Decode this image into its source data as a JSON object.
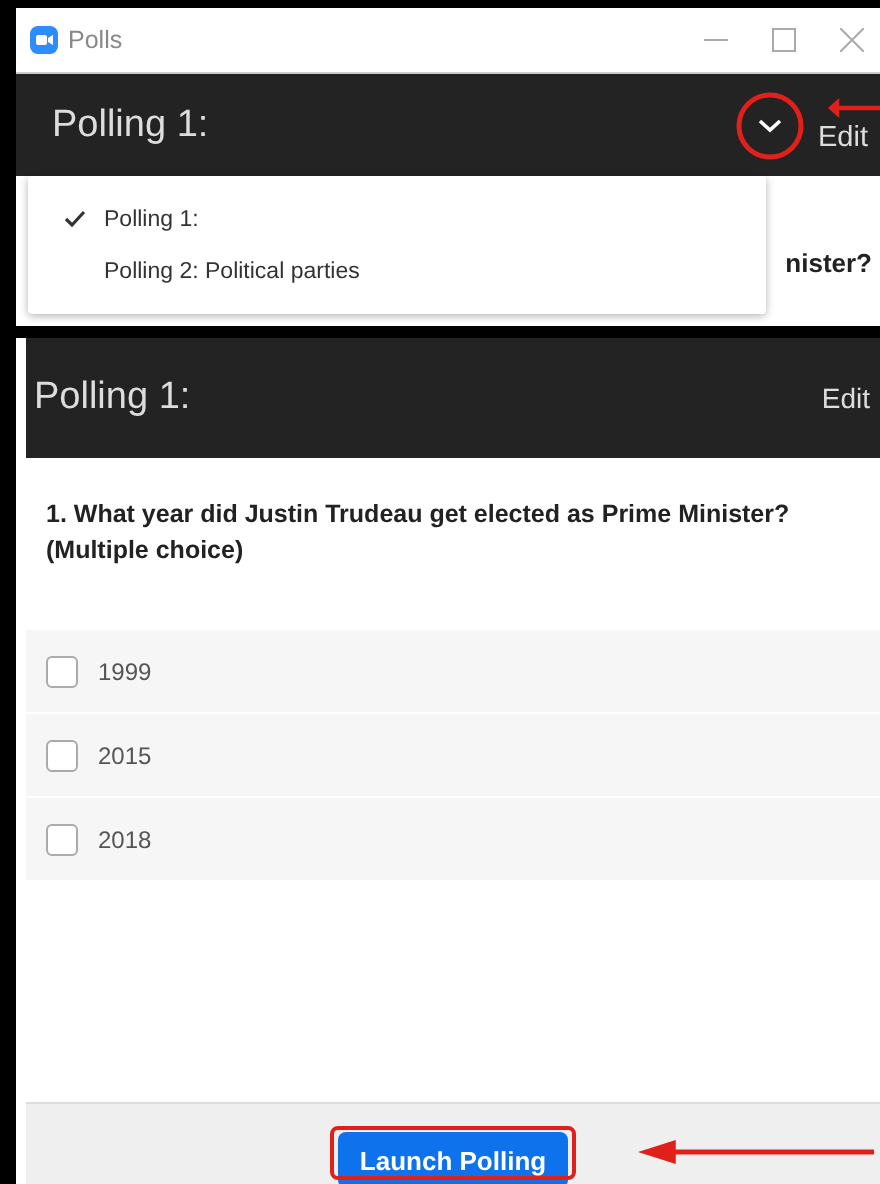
{
  "window": {
    "title": "Polls"
  },
  "header": {
    "title": "Polling 1:",
    "edit": "Edit"
  },
  "poll_menu": {
    "items": [
      {
        "label": "Polling 1:",
        "selected": true
      },
      {
        "label": "Polling 2: Political parties",
        "selected": false
      }
    ]
  },
  "covered_question": {
    "text": "nister?"
  },
  "panel": {
    "title": "Polling 1:",
    "edit": "Edit",
    "question": "1. What year did Justin Trudeau get elected as Prime Minister? (Multiple choice)",
    "options": [
      {
        "label": "1999",
        "checked": false
      },
      {
        "label": "2015",
        "checked": false
      },
      {
        "label": "2018",
        "checked": false
      }
    ],
    "button": "Launch Polling"
  },
  "annotations": {
    "menu_toggle_highlighted": true,
    "launch_button_highlighted": true
  }
}
